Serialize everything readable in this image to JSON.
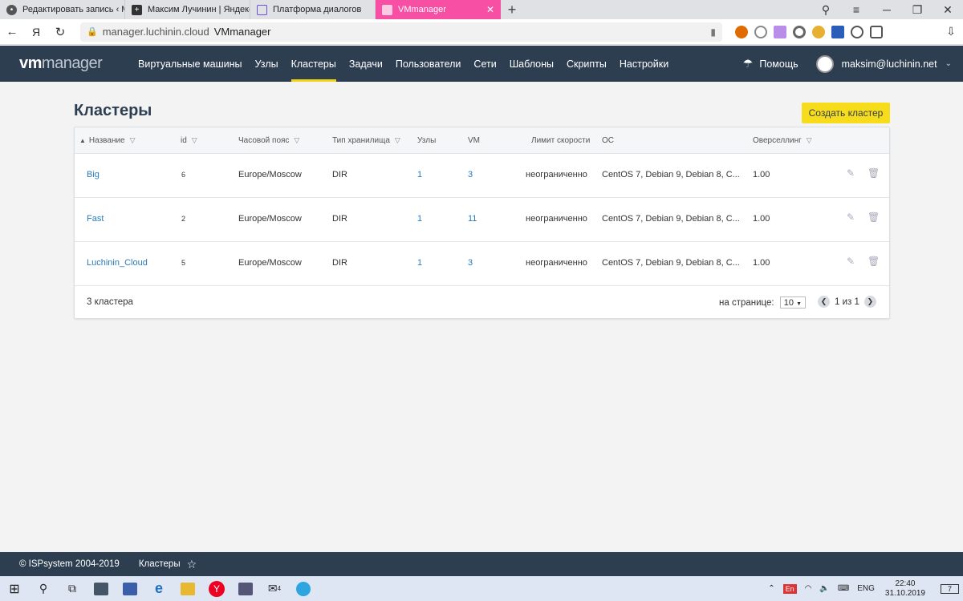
{
  "browser": {
    "tabs": [
      {
        "label": "Редактировать запись ‹ Ма",
        "active": false
      },
      {
        "label": "Максим Лучинин | Яндекс",
        "active": false
      },
      {
        "label": "Платформа диалогов",
        "active": false
      },
      {
        "label": "VMmanager",
        "active": true
      }
    ],
    "url_host": "manager.luchinin.cloud",
    "page_title": "VMmanager",
    "yandex_label": "Я"
  },
  "app": {
    "logo_bold": "vm",
    "logo_rest": "manager",
    "nav": [
      {
        "label": "Виртуальные машины"
      },
      {
        "label": "Узлы"
      },
      {
        "label": "Кластеры"
      },
      {
        "label": "Задачи"
      },
      {
        "label": "Пользователи"
      },
      {
        "label": "Сети"
      },
      {
        "label": "Шаблоны"
      },
      {
        "label": "Скрипты"
      },
      {
        "label": "Настройки"
      }
    ],
    "active_nav": "Кластеры",
    "help": "Помощь",
    "user": "maksim@luchinin.net"
  },
  "page": {
    "title": "Кластеры",
    "create_button": "Создать кластер"
  },
  "table": {
    "columns": {
      "name": "Название",
      "id": "id",
      "tz": "Часовой пояс",
      "storage": "Тип хранилища",
      "nodes": "Узлы",
      "vm": "VM",
      "speed": "Лимит скорости",
      "os": "ОС",
      "overselling": "Оверселлинг"
    },
    "rows": [
      {
        "name": "Big",
        "id": "6",
        "tz": "Europe/Moscow",
        "storage": "DIR",
        "nodes": "1",
        "vm": "3",
        "speed": "неограниченно",
        "os": "CentOS 7, Debian 9, Debian 8, C...",
        "overselling": "1.00"
      },
      {
        "name": "Fast",
        "id": "2",
        "tz": "Europe/Moscow",
        "storage": "DIR",
        "nodes": "1",
        "vm": "11",
        "speed": "неограниченно",
        "os": "CentOS 7, Debian 9, Debian 8, C...",
        "overselling": "1.00"
      },
      {
        "name": "Luchinin_Cloud",
        "id": "5",
        "tz": "Europe/Moscow",
        "storage": "DIR",
        "nodes": "1",
        "vm": "3",
        "speed": "неограниченно",
        "os": "CentOS 7, Debian 9, Debian 8, C...",
        "overselling": "1.00"
      }
    ],
    "footer": {
      "count": "3 кластера",
      "per_page_label": "на странице:",
      "per_page_value": "10",
      "page_text": "1 из 1"
    }
  },
  "app_footer": {
    "copyright": "© ISPsystem 2004-2019",
    "breadcrumb": "Кластеры"
  },
  "taskbar": {
    "lang": "ENG",
    "kbd": "En",
    "time": "22:40",
    "date": "31.10.2019",
    "notif_count": "7",
    "mail_badge": "4"
  },
  "colors": {
    "header_bg": "#2c3e50",
    "accent": "#f5d31a",
    "active_tab": "#f74fa4",
    "link": "#2a7ab9"
  }
}
